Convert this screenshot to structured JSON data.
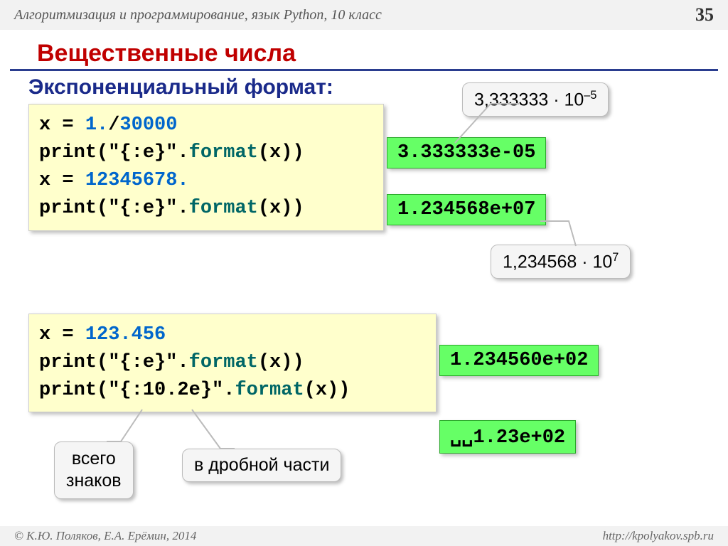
{
  "header": {
    "course": "Алгоритмизация и программирование, язык Python, 10 класс",
    "page": "35"
  },
  "title": "Вещественные числа",
  "subtitle": "Экспоненциальный формат:",
  "code1": {
    "l1a": "x = ",
    "l1b": "1.",
    "l1c": "/",
    "l1d": "30000",
    "l2a": "print(",
    "l2b": "\"{:e}\"",
    "l2c": ".",
    "l2d": "format",
    "l2e": "(x))",
    "l3a": "x = ",
    "l3b": "12345678.",
    "l4a": "print(",
    "l4b": "\"{:e}\"",
    "l4c": ".",
    "l4d": "format",
    "l4e": "(x))"
  },
  "code2": {
    "l1a": "x = ",
    "l1b": "123.456",
    "l2a": "print(",
    "l2b": "\"{:e}\"",
    "l2c": ".",
    "l2d": "format",
    "l2e": "(x))",
    "l3a": "print(",
    "l3b": "\"{:10.2e}\"",
    "l3c": ".",
    "l3d": "format",
    "l3e": "(x))"
  },
  "results": {
    "r1": "3.333333e-05",
    "r2": "1.234568e+07",
    "r3": "1.234560e+02",
    "r4": "␣␣1.23e+02"
  },
  "callouts": {
    "c1a": "3,333333 · 10",
    "c1b": "–5",
    "c2a": "1,234568 · 10",
    "c2b": "7",
    "c3l1": "всего",
    "c3l2": "знаков",
    "c4": "в дробной части"
  },
  "footer": {
    "left": "© К.Ю. Поляков, Е.А. Ерёмин, 2014",
    "right": "http://kpolyakov.spb.ru"
  }
}
